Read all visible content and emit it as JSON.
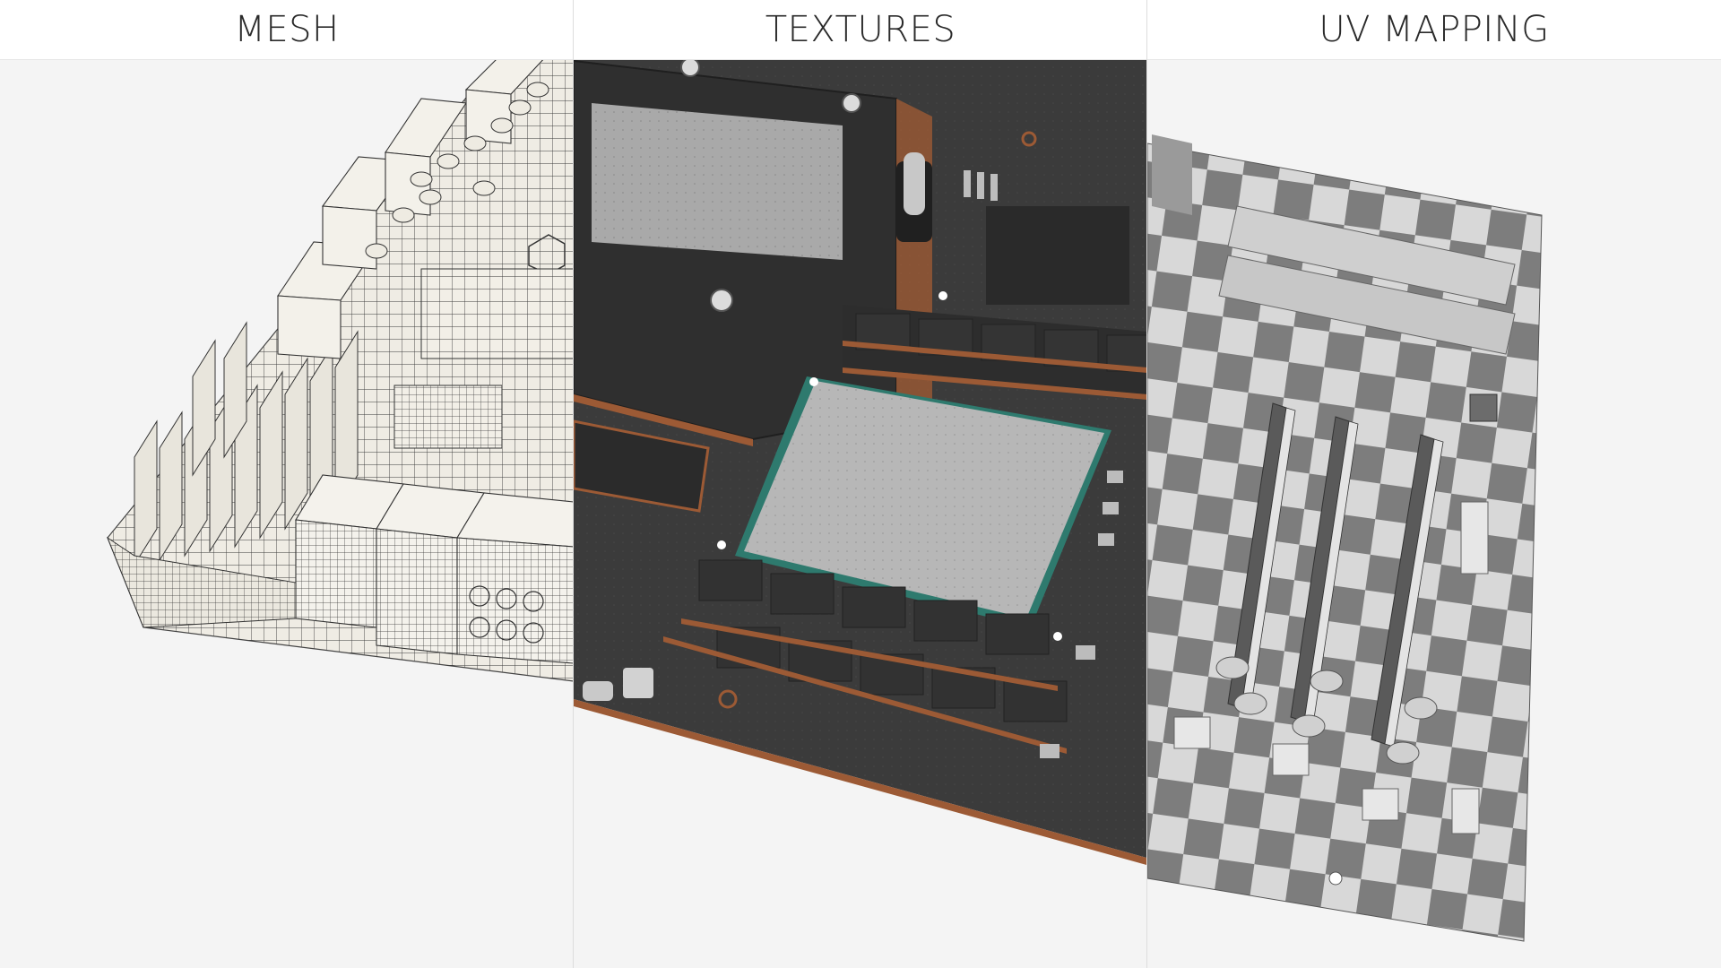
{
  "panels": [
    {
      "label": "MESH"
    },
    {
      "label": "TEXTURES"
    },
    {
      "label": "UV MAPPING"
    }
  ],
  "colors": {
    "background": "#f4f4f4",
    "header_bg": "#ffffff",
    "header_text": "#2a2a2a",
    "board_dark": "#3a3a3a",
    "copper_trace": "#b0643a",
    "chip_gray": "#b9b9b9",
    "mesh_fill": "#efece4",
    "checker_light": "#d8d8d8",
    "checker_dark": "#7d7d7d"
  },
  "icons": [
    "motherboard-render",
    "wireframe-mesh",
    "checker-uv-pattern"
  ]
}
